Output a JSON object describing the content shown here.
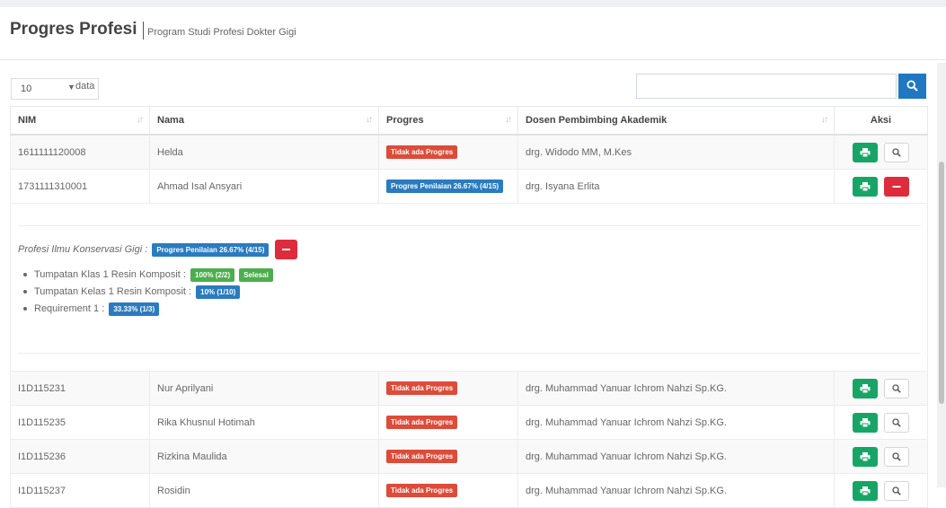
{
  "header": {
    "title": "Progres Profesi",
    "subtitle": "Program Studi Profesi Dokter Gigi"
  },
  "controls": {
    "length_value": "10",
    "length_label": "data",
    "search_value": ""
  },
  "table": {
    "columns": [
      "NIM",
      "Nama",
      "Progres",
      "Dosen Pembimbing Akademik",
      "Aksi"
    ],
    "rows": [
      {
        "nim": "1611111120008",
        "nama": "Helda",
        "progres": "Tidak ada Progres",
        "dosen": "drg. Widodo MM, M.Kes"
      },
      {
        "nim": "1731111310001",
        "nama": "Ahmad Isal Ansyari",
        "progres": "Progres Penilaian 26.67% (4/15)",
        "dosen": "drg. Isyana Erlita"
      },
      {
        "nim": "I1D115231",
        "nama": "Nur Aprilyani",
        "progres": "Tidak ada Progres",
        "dosen": "drg. Muhammad Yanuar Ichrom Nahzi Sp.KG."
      },
      {
        "nim": "I1D115235",
        "nama": "Rika Khusnul Hotimah",
        "progres": "Tidak ada Progres",
        "dosen": "drg. Muhammad Yanuar Ichrom Nahzi Sp.KG."
      },
      {
        "nim": "I1D115236",
        "nama": "Rizkina Maulida",
        "progres": "Tidak ada Progres",
        "dosen": "drg. Muhammad Yanuar Ichrom Nahzi Sp.KG."
      },
      {
        "nim": "I1D115237",
        "nama": "Rosidin",
        "progres": "Tidak ada Progres",
        "dosen": "drg. Muhammad Yanuar Ichrom Nahzi Sp.KG."
      }
    ]
  },
  "detail": {
    "heading": "Profesi Ilmu Konservasi Gigi :",
    "heading_badge": "Progres Penilaian 26.67% (4/15)",
    "items": [
      {
        "label": "Tumpatan Klas 1 Resin Komposit :",
        "badge": "100% (2/2)",
        "extra_badge": "Selesai"
      },
      {
        "label": "Tumpatan Kelas 1 Resin Komposit :",
        "badge": "10% (1/10)"
      },
      {
        "label": "Requirement 1 :",
        "badge": "33.33% (1/3)"
      }
    ]
  },
  "colors": {
    "primary": "#1f78c1",
    "success": "#17a566",
    "danger": "#dd2c3b"
  },
  "icons": {
    "print": "printer-icon",
    "view": "search-icon",
    "collapse": "minus-icon"
  }
}
